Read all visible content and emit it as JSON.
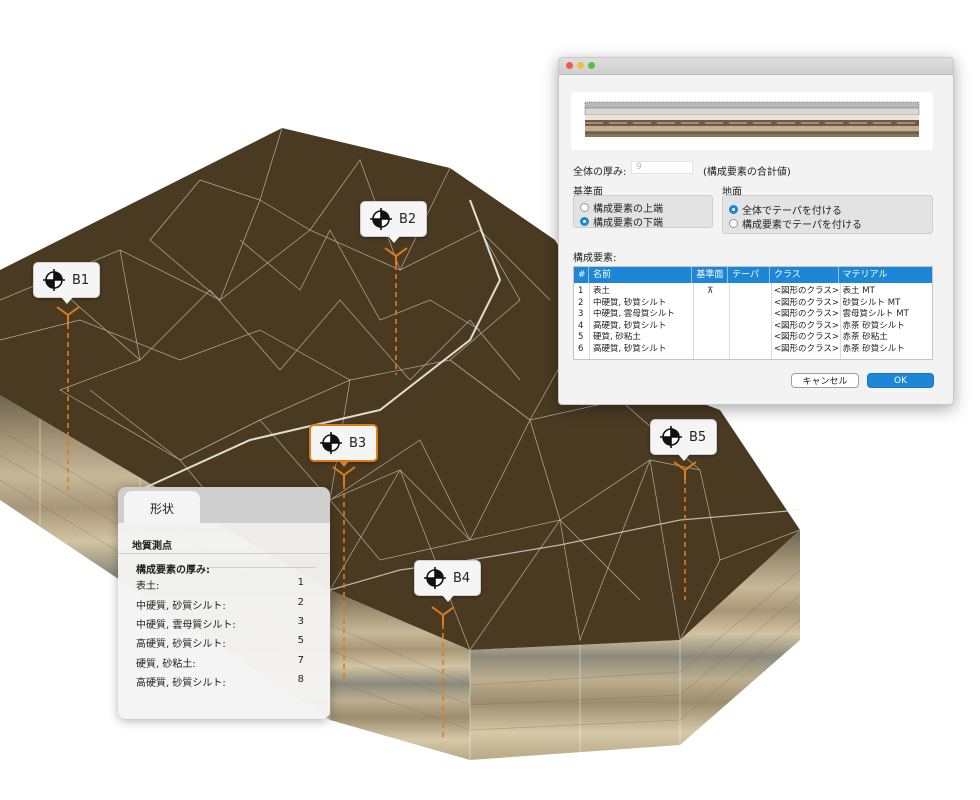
{
  "boreholes": [
    {
      "label": "B1",
      "selected": false
    },
    {
      "label": "B2",
      "selected": false
    },
    {
      "label": "B3",
      "selected": true
    },
    {
      "label": "B4",
      "selected": false
    },
    {
      "label": "B5",
      "selected": false
    }
  ],
  "dialog": {
    "total_thickness_label": "全体の厚み:",
    "total_thickness_value": "9",
    "total_thickness_note": "(構成要素の合計値)",
    "reference_group_label": "基準面",
    "reference_options": [
      {
        "label": "構成要素の上端",
        "selected": false
      },
      {
        "label": "構成要素の下端",
        "selected": true
      }
    ],
    "ground_group_label": "地面",
    "ground_options": [
      {
        "label": "全体でテーパを付ける",
        "selected": true
      },
      {
        "label": "構成要素でテーパを付ける",
        "selected": false
      }
    ],
    "components_label": "構成要素:",
    "table": {
      "headers": [
        "#",
        "名前",
        "基準面",
        "テーパ",
        "クラス",
        "マテリアル"
      ],
      "rows": [
        {
          "num": "1",
          "name": "表土",
          "ref": "⊼",
          "taper": "",
          "cls": "<図形のクラス>",
          "mat": "表土 MT"
        },
        {
          "num": "2",
          "name": "中硬質, 砂質シルト",
          "ref": "",
          "taper": "",
          "cls": "<図形のクラス>",
          "mat": "砂質シルト MT"
        },
        {
          "num": "3",
          "name": "中硬質, 雲母質シルト",
          "ref": "",
          "taper": "",
          "cls": "<図形のクラス>",
          "mat": "雲母質シルト MT"
        },
        {
          "num": "4",
          "name": "高硬質, 砂質シルト",
          "ref": "",
          "taper": "",
          "cls": "<図形のクラス>",
          "mat": "赤茶 砂質シルト"
        },
        {
          "num": "5",
          "name": "硬質, 砂粘土",
          "ref": "",
          "taper": "",
          "cls": "<図形のクラス>",
          "mat": "赤茶 砂粘土"
        },
        {
          "num": "6",
          "name": "高硬質, 砂質シルト",
          "ref": "",
          "taper": "",
          "cls": "<図形のクラス>",
          "mat": "赤茶 砂質シルト"
        }
      ]
    },
    "cancel_label": "キャンセル",
    "ok_label": "OK"
  },
  "shape_palette": {
    "tab_label": "形状",
    "object_type": "地質測点",
    "section_label": "構成要素の厚み:",
    "rows": [
      {
        "label": "表土:",
        "value": "1"
      },
      {
        "label": "中硬質, 砂質シルト:",
        "value": "2"
      },
      {
        "label": "中硬質, 雲母質シルト:",
        "value": "3"
      },
      {
        "label": "高硬質, 砂質シルト:",
        "value": "5"
      },
      {
        "label": "硬質, 砂粘土:",
        "value": "7"
      },
      {
        "label": "高硬質, 砂質シルト:",
        "value": "8"
      }
    ]
  },
  "colors": {
    "terrain_top": "#4a3a22",
    "accent_orange": "#e07b1a",
    "accent_blue": "#1d86d6"
  }
}
